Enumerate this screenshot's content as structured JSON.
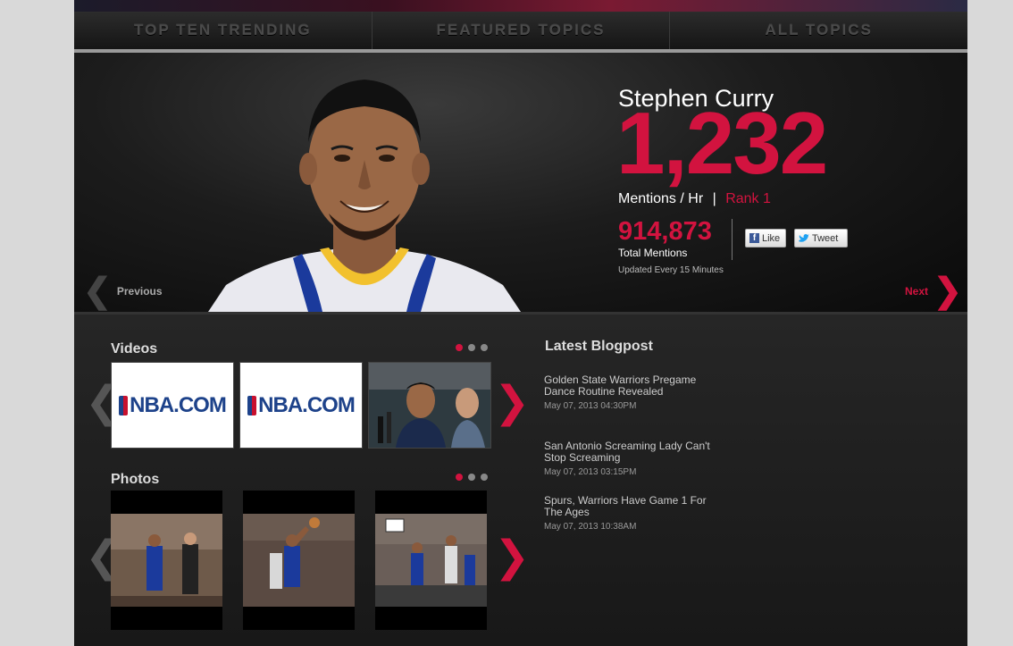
{
  "nav": {
    "tabs": [
      {
        "label": "TOP TEN TRENDING"
      },
      {
        "label": "FEATURED TOPICS"
      },
      {
        "label": "ALL TOPICS"
      }
    ]
  },
  "hero": {
    "name": "Stephen Curry",
    "mentions_per_hour": "1,232",
    "mentions_label": "Mentions / Hr",
    "separator": "|",
    "rank": "Rank 1",
    "total_mentions": "914,873",
    "total_label": "Total Mentions",
    "updated": "Updated Every 15 Minutes",
    "like_label": "Like",
    "tweet_label": "Tweet",
    "prev_label": "Previous",
    "next_label": "Next"
  },
  "videos": {
    "title": "Videos",
    "thumbs": [
      {
        "logo_text": "NBA.COM"
      },
      {
        "logo_text": "NBA.COM"
      },
      {
        "logo_text": ""
      }
    ]
  },
  "photos": {
    "title": "Photos"
  },
  "blog": {
    "title": "Latest Blogpost",
    "posts": [
      {
        "title": "Golden State Warriors Pregame Dance Routine Revealed",
        "date": "May 07, 2013 04:30PM"
      },
      {
        "title": "San Antonio Screaming Lady Can't Stop Screaming",
        "date": "May 07, 2013 03:15PM"
      },
      {
        "title": "Spurs, Warriors Have Game 1 For The Ages",
        "date": "May 07, 2013 10:38AM"
      }
    ]
  },
  "colors": {
    "accent": "#d2133f",
    "background": "#1a1a1a"
  }
}
